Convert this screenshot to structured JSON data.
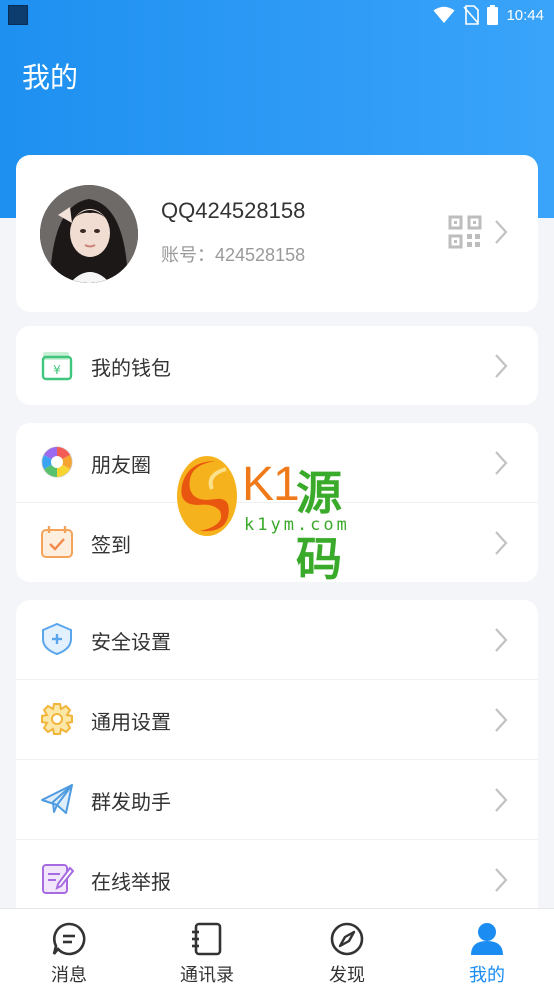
{
  "status_bar": {
    "time": "10:44"
  },
  "header": {
    "title": "我的"
  },
  "profile": {
    "name": "QQ424528158",
    "account_label": "账号：",
    "account_number": "424528158"
  },
  "menu_groups": [
    {
      "items": [
        {
          "label": "我的钱包",
          "icon": "wallet-icon"
        }
      ]
    },
    {
      "items": [
        {
          "label": "朋友圈",
          "icon": "moments-icon"
        },
        {
          "label": "签到",
          "icon": "calendar-checkin-icon"
        }
      ]
    },
    {
      "items": [
        {
          "label": "安全设置",
          "icon": "shield-icon"
        },
        {
          "label": "通用设置",
          "icon": "gear-icon"
        },
        {
          "label": "群发助手",
          "icon": "paper-plane-icon"
        },
        {
          "label": "在线举报",
          "icon": "report-edit-icon"
        }
      ]
    }
  ],
  "watermark": {
    "brand": "K1",
    "brand_cn": "源码",
    "url": "k1ym.com"
  },
  "bottom_nav": {
    "items": [
      {
        "label": "消息",
        "icon": "message-icon"
      },
      {
        "label": "通讯录",
        "icon": "contacts-icon"
      },
      {
        "label": "发现",
        "icon": "compass-icon"
      },
      {
        "label": "我的",
        "icon": "person-icon",
        "active": true
      }
    ]
  },
  "colors": {
    "primary": "#1a8cf2",
    "background": "#f3f5f8",
    "text": "#333333",
    "subtext": "#9a9a9a"
  }
}
